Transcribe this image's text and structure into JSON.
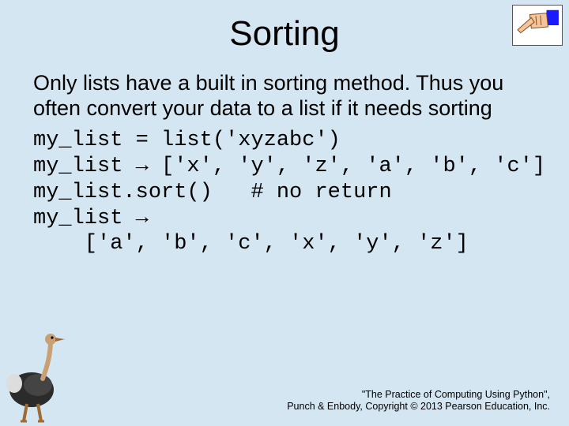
{
  "title": "Sorting",
  "intro": "Only lists have a built in sorting method. Thus you often convert your data to a list if it needs sorting",
  "code_lines": {
    "l1": "my_list = list('xyzabc')",
    "l2": "my_list → ['x', 'y', 'z', 'a', 'b', 'c']",
    "l3": "my_list.sort()   # no return",
    "l4": "my_list →",
    "l5": "    ['a', 'b', 'c', 'x', 'y', 'z']"
  },
  "footer": {
    "line1": "\"The Practice of Computing Using Python\",",
    "line2": "Punch & Enbody, Copyright © 2013 Pearson Education, Inc."
  }
}
